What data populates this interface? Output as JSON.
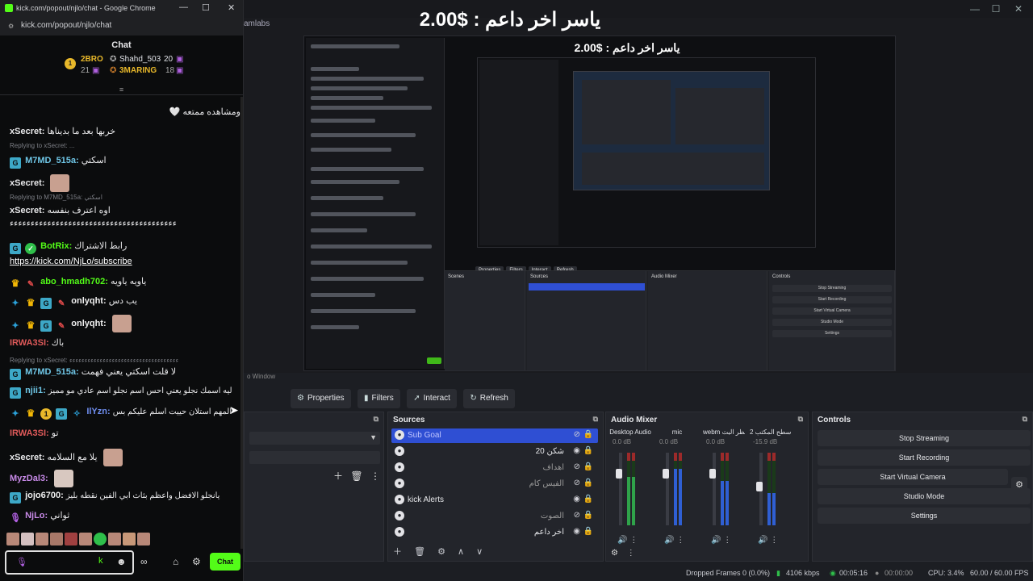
{
  "obs": {
    "brand": "amlabs",
    "overlay_text": "ياسر اخر داعم : $2.00",
    "nested_overlay_text": "ياسر اخر داعم : $2.00",
    "preview_label": "o Window",
    "buttons": [
      {
        "icon": "gear-icon",
        "label": "Properties"
      },
      {
        "icon": "filter-icon",
        "label": "Filters"
      },
      {
        "icon": "cursor-icon",
        "label": "Interact"
      },
      {
        "icon": "refresh-icon",
        "label": "Refresh"
      }
    ],
    "sources": {
      "title": "Sources",
      "items": [
        {
          "name": "Sub Goal",
          "selected": true,
          "visible": false
        },
        {
          "name": "شكن 20",
          "selected": false,
          "visible": true
        },
        {
          "name": "اهداف",
          "selected": false,
          "visible": false
        },
        {
          "name": "الفيس كام",
          "selected": false,
          "visible": false
        },
        {
          "name": "kick Alerts",
          "selected": false,
          "visible": true
        },
        {
          "name": "الصوت",
          "selected": false,
          "visible": false
        },
        {
          "name": "اخر داعم",
          "selected": false,
          "visible": true
        }
      ]
    },
    "mixer": {
      "title": "Audio Mixer",
      "channels": [
        {
          "name": "Desktop Audio",
          "db": "0.0 dB"
        },
        {
          "name": "mic",
          "db": "0.0 dB"
        },
        {
          "name": "webm انتظر البث",
          "db": "0.0 dB"
        },
        {
          "name": "صوت سطح المكتب 2",
          "db": "-15.9 dB"
        }
      ],
      "scale": [
        "5",
        "0",
        "-5",
        "-10",
        "-15",
        "-20",
        "-25",
        "-30",
        "-35",
        "-40",
        "-45",
        "-50",
        "-55",
        "-60"
      ]
    },
    "controls": {
      "title": "Controls",
      "buttons": [
        "Stop Streaming",
        "Start Recording",
        "Start Virtual Camera",
        "Studio Mode",
        "Settings"
      ]
    },
    "status": {
      "dropped_frames": "Dropped Frames 0 (0.0%)",
      "kbps": "4106 kbps",
      "stream_time": "00:05:16",
      "record_time": "00:00:00",
      "cpu": "CPU: 3.4%",
      "fps": "60.00 / 60.00 FPS"
    }
  },
  "chrome": {
    "title": "kick.com/popout/njlo/chat - Google Chrome",
    "url": "kick.com/popout/njlo/chat"
  },
  "chat": {
    "header": "Chat",
    "leaderboard": [
      {
        "rank": "1",
        "name": "2BRO",
        "count": "21"
      },
      {
        "rank": "",
        "name": "Shahd_503",
        "count": "20"
      },
      {
        "rank": "",
        "name": "3MARING",
        "count": "18"
      }
    ],
    "messages": [
      {
        "user": "",
        "text": "ومشاهده ممتعه 🤍"
      },
      {
        "user": "xSecret:",
        "text": "خربها بعد ما بديناها"
      },
      {
        "user": "M7MD_515a:",
        "text": "اسكتي"
      },
      {
        "user": "xSecret:",
        "text": ""
      },
      {
        "reply": "Replying to M7MD_515a: اسكتي"
      },
      {
        "user": "xSecret:",
        "text": "اوه اعترف بنفسه"
      },
      {
        "user": "",
        "text": "ء"
      },
      {
        "user": "BotRix:",
        "text": "رابط الاشتراك"
      },
      {
        "user": "",
        "text": "https://kick.com/NjLo/subscribe"
      },
      {
        "user": "abo_hmadh702:",
        "text": "ياويه ياويه"
      },
      {
        "user": "onlyqht:",
        "text": "يب دس"
      },
      {
        "user": "onlyqht:",
        "text": ""
      },
      {
        "user": "IRWA3SI:",
        "text": "باك"
      },
      {
        "reply": "Replying to xSecret: ءءءءءءءءءءءءءءءءءء"
      },
      {
        "user": "M7MD_515a:",
        "text": "لا قلت اسكتي يعني فهمت"
      },
      {
        "user": "njii1:",
        "text": "ليه اسمك نجلو يعني احس اسم نجلو اسم عادي مو مميز"
      },
      {
        "user": "IlYzn:",
        "text": "المهم استلان حييت اسلم عليكم بس"
      },
      {
        "user": "IRWA3SI:",
        "text": "تو"
      },
      {
        "user": "xSecret:",
        "text": "يلا مع السلامه"
      },
      {
        "user": "MyzDal3:",
        "text": ""
      },
      {
        "user": "jojo6700:",
        "text": "يانجلو الافضل واعظم بثاث ابي الفين نقطه بليز"
      },
      {
        "user": "NjLo:",
        "text": "ثواني"
      }
    ],
    "reply_1": "Replying to xSecret: ...",
    "reply_2": "Replying to M7MD_515a: اسكتي",
    "reply_3": "Replying to xSecret: ءءءءءءءءءءءءءءءءءءءءءءءءءءءءءءءءءءءء",
    "send_label": "Chat"
  }
}
